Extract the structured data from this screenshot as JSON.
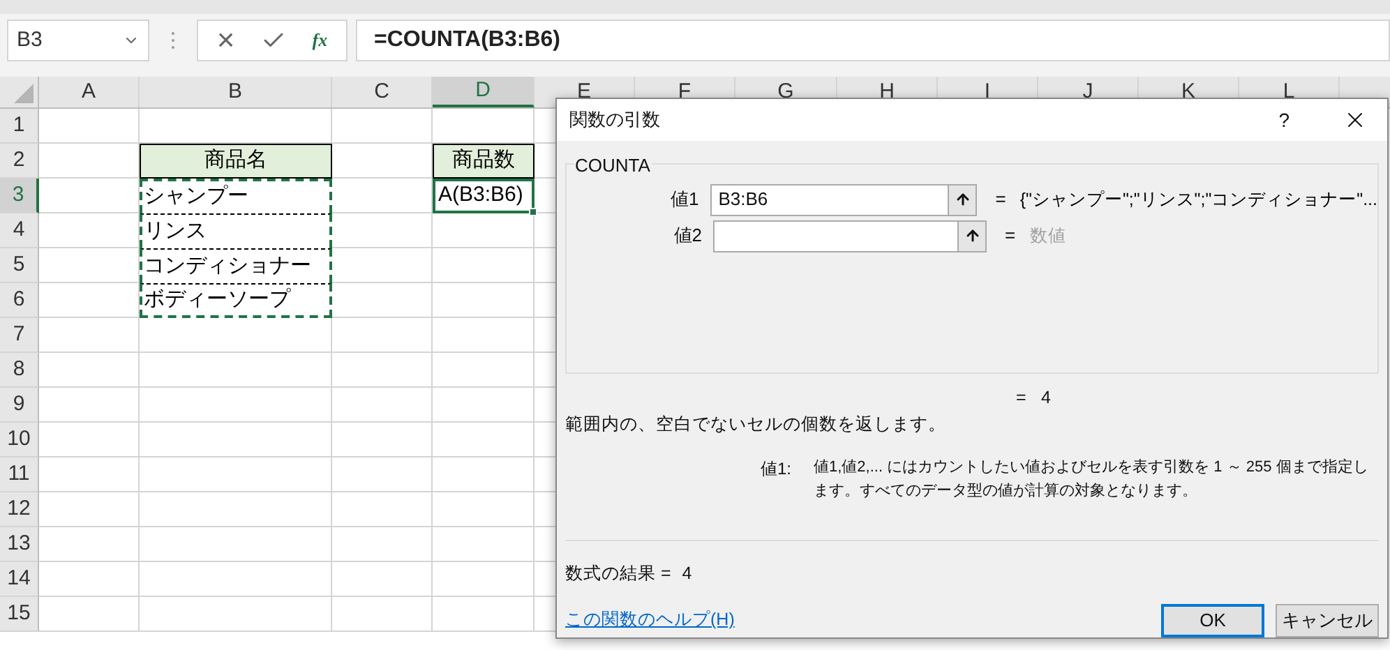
{
  "name_box": {
    "value": "B3"
  },
  "formula_bar": {
    "cancel_icon": "×",
    "function_button": "fx",
    "value": "=COUNTA(B3:B6)"
  },
  "columns": [
    {
      "label": "A",
      "selected": false
    },
    {
      "label": "B",
      "selected": false
    },
    {
      "label": "C",
      "selected": false
    },
    {
      "label": "D",
      "selected": true
    },
    {
      "label": "E",
      "selected": false
    },
    {
      "label": "F",
      "selected": false
    },
    {
      "label": "G",
      "selected": false
    },
    {
      "label": "H",
      "selected": false
    },
    {
      "label": "I",
      "selected": false
    },
    {
      "label": "J",
      "selected": false
    },
    {
      "label": "K",
      "selected": false
    },
    {
      "label": "L",
      "selected": false
    }
  ],
  "rows": [
    {
      "label": "1",
      "selected": false
    },
    {
      "label": "2",
      "selected": false,
      "cells": [
        {
          "kind": "blank"
        },
        {
          "kind": "header",
          "text": "商品名"
        },
        {
          "kind": "blank"
        },
        {
          "kind": "header",
          "text": "商品数"
        }
      ]
    },
    {
      "label": "3",
      "selected": true,
      "cells": [
        {
          "kind": "blank"
        },
        {
          "kind": "copied",
          "text": "シャンプー"
        },
        {
          "kind": "blank"
        },
        {
          "kind": "active",
          "text": "A(B3:B6)"
        }
      ]
    },
    {
      "label": "4",
      "selected": false,
      "cells": [
        {
          "kind": "blank"
        },
        {
          "kind": "copied",
          "text": "リンス"
        }
      ]
    },
    {
      "label": "5",
      "selected": false,
      "cells": [
        {
          "kind": "blank"
        },
        {
          "kind": "copied",
          "text": "コンディショナー"
        }
      ]
    },
    {
      "label": "6",
      "selected": false,
      "cells": [
        {
          "kind": "blank"
        },
        {
          "kind": "copied",
          "text": "ボディーソープ"
        }
      ]
    },
    {
      "label": "7",
      "selected": false
    },
    {
      "label": "8",
      "selected": false
    },
    {
      "label": "9",
      "selected": false
    },
    {
      "label": "10",
      "selected": false
    },
    {
      "label": "11",
      "selected": false
    },
    {
      "label": "12",
      "selected": false
    },
    {
      "label": "13",
      "selected": false
    },
    {
      "label": "14",
      "selected": false
    },
    {
      "label": "15",
      "selected": false
    }
  ],
  "dialog": {
    "title": "関数の引数",
    "help": "?",
    "function_name": "COUNTA",
    "arguments": [
      {
        "label": "値1",
        "value": "B3:B6",
        "equals": "=",
        "result": "{\"シャンプー\";\"リンス\";\"コンディショナー\"...",
        "greyed": false
      },
      {
        "label": "値2",
        "equals": "=",
        "result": "数値",
        "greyed": true
      }
    ],
    "total": {
      "equals": "=",
      "value": "4"
    },
    "description": "範囲内の、空白でないセルの個数を返します。",
    "argument_help": {
      "label": "値1:",
      "text": "値1,値2,... にはカウントしたい値およびセルを表す引数を 1 ～ 255 個まで指定します。すべてのデータ型の値が計算の対象となります。"
    },
    "formula_result": {
      "label": "数式の結果 =",
      "value": "4"
    },
    "help_link": "この関数のヘルプ(H)",
    "buttons": [
      {
        "label": "OK",
        "default": true
      },
      {
        "label": "キャンセル",
        "default": false
      }
    ]
  }
}
